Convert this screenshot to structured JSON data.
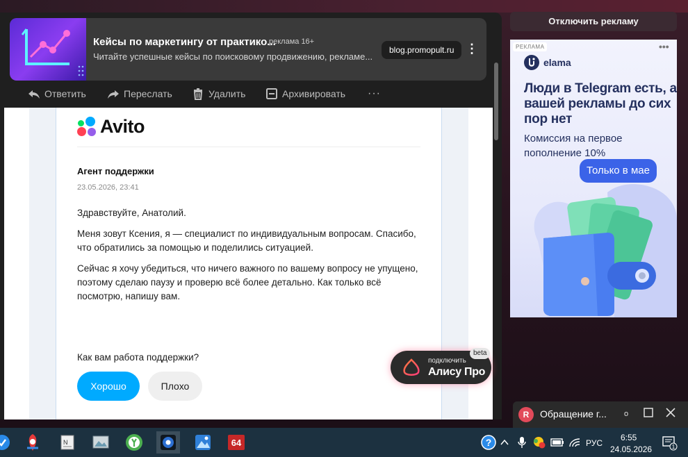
{
  "ad_banner": {
    "title": "Кейсы по маркетингу от практико...",
    "mark": "реклама  16+",
    "description": "Читайте успешные кейсы по поисковому продвижению, рекламе...",
    "domain": "blog.promopult.ru"
  },
  "toolbar": {
    "reply": "Ответить",
    "forward": "Переслать",
    "delete": "Удалить",
    "archive": "Архивировать",
    "more": "···"
  },
  "letter": {
    "brand": "Avito",
    "sender": "Агент поддержки",
    "datetime": "23.05.2026, 23:41",
    "greeting": "Здравствуйте, Анатолий.",
    "para1": "Меня зовут Ксения, я — специалист по индивидуальным вопросам. Спасибо, что обратились за помощью и поделились ситуацией.",
    "para2": "Сейчас я хочу убедиться, что ничего важного по вашему вопросу не упущено, поэтому сделаю паузу и проверю всё более детально. Как только всё посмотрю, напишу вам.",
    "question": "Как вам работа поддержки?",
    "good": "Хорошо",
    "bad": "Плохо"
  },
  "alice": {
    "small": "подключить",
    "big": "Алису Про",
    "beta": "beta"
  },
  "side": {
    "disable_ad": "Отключить рекламу",
    "tag": "РЕКЛАМА",
    "more": "•••",
    "brand": "elama",
    "headline": "Люди в Telegram есть, а вашей рекламы до сих пор нет",
    "sub": "Комиссия на первое пополнение 10%",
    "pill": "Только в мае"
  },
  "notification": {
    "avatar": "R",
    "title": "Обращение г..."
  },
  "taskbar": {
    "lang": "РУС",
    "time": "6:55",
    "date": "24.05.2026",
    "app_badge": "64",
    "notif_count": "1"
  },
  "colors": {
    "accent_blue": "#00aaff",
    "ad_blue": "#3b63e8"
  }
}
